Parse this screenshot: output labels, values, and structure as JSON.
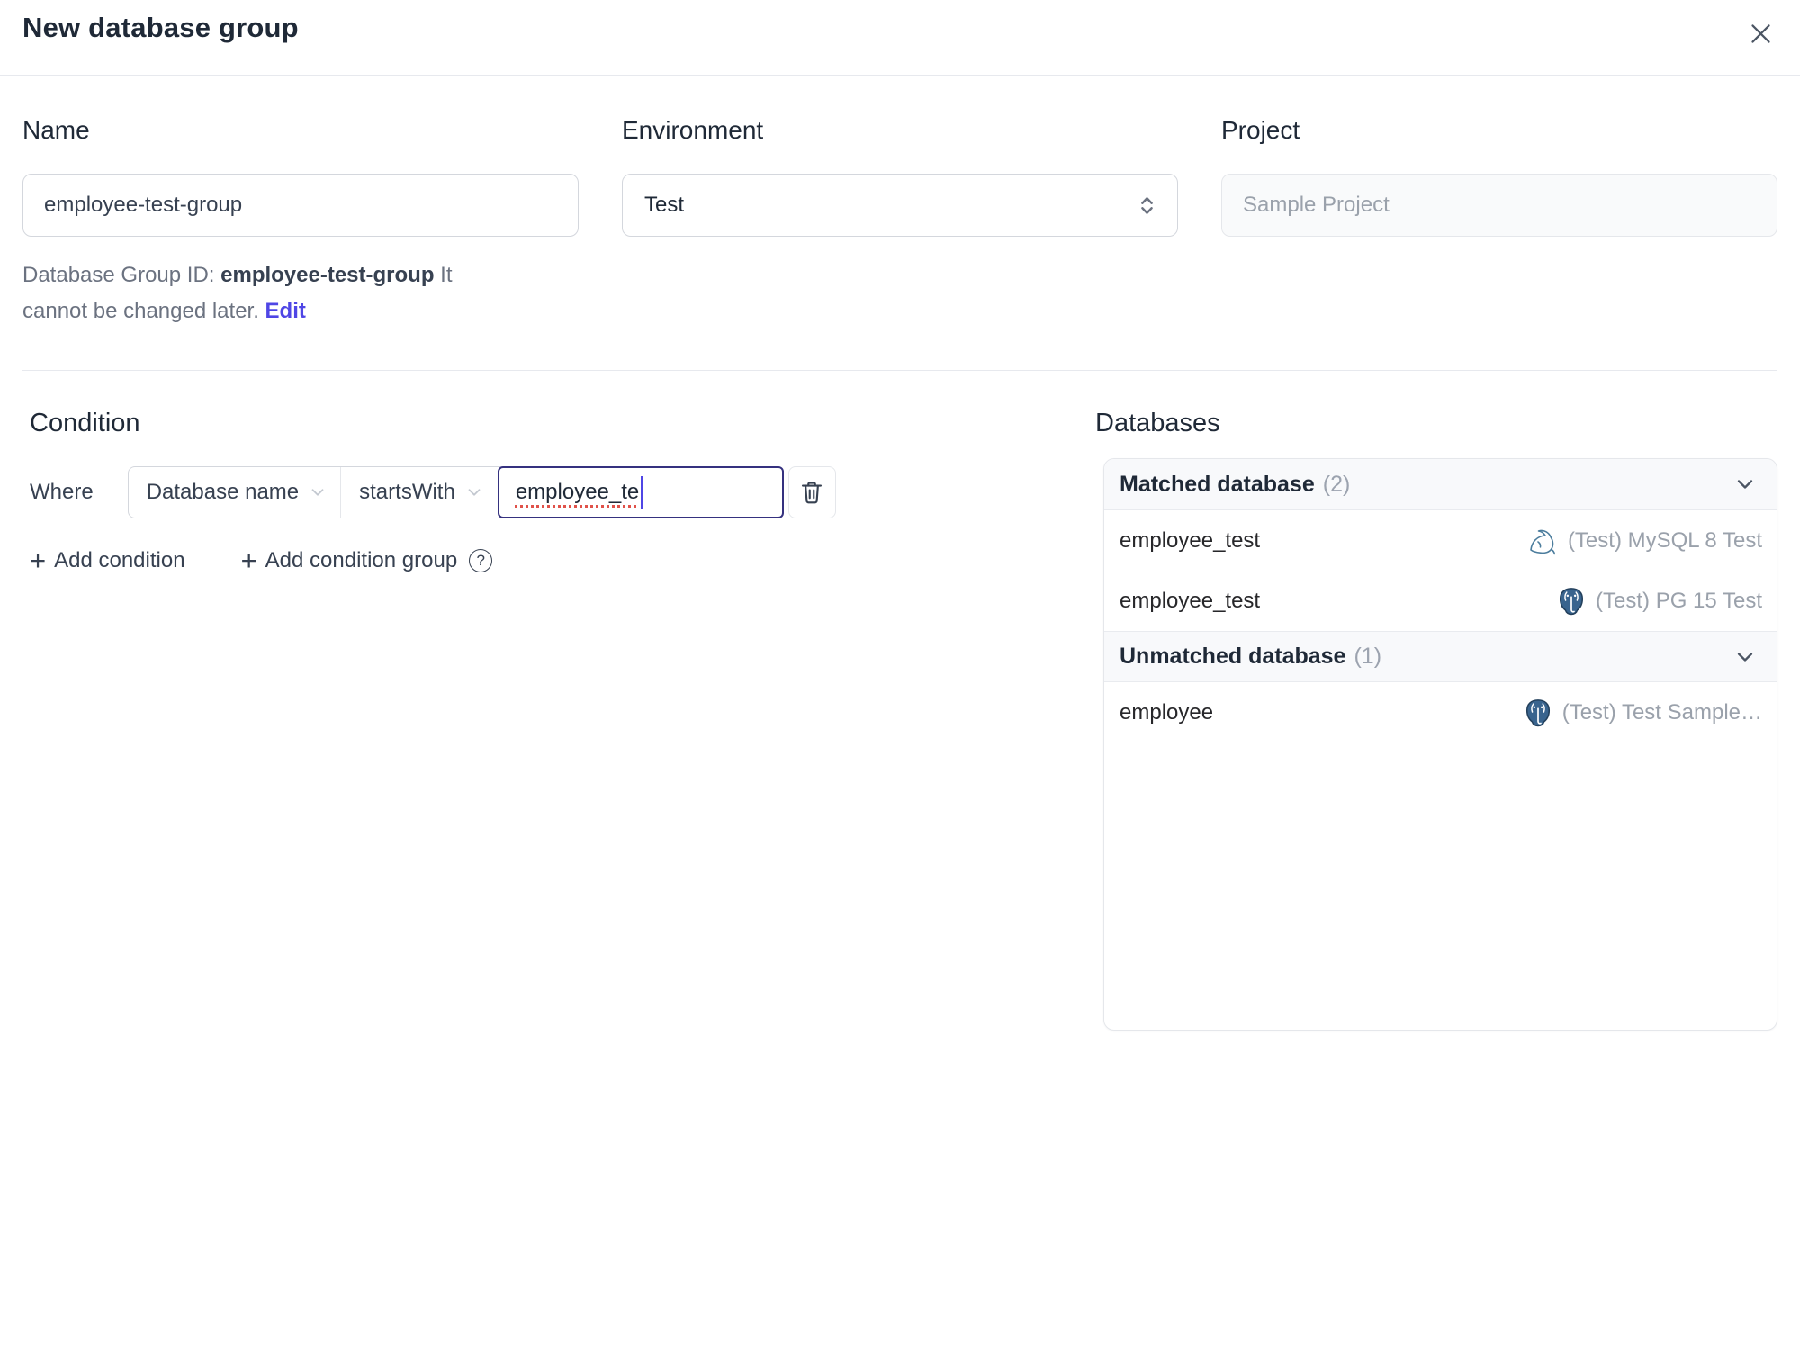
{
  "dialog": {
    "title": "New database group"
  },
  "form": {
    "name": {
      "label": "Name",
      "value": "employee-test-group"
    },
    "environment": {
      "label": "Environment",
      "value": "Test"
    },
    "project": {
      "label": "Project",
      "value": "Sample Project"
    },
    "id_hint": {
      "prefix": "Database Group ID: ",
      "id": "employee-test-group",
      "suffix": " It cannot be changed later. ",
      "edit_label": "Edit"
    }
  },
  "condition": {
    "heading": "Condition",
    "where_label": "Where",
    "field_selected": "Database name",
    "operator_selected": "startsWith",
    "value": "employee_te",
    "plus_glyph": "+",
    "add_condition_label": "Add condition",
    "add_condition_group_label": "Add condition group",
    "help_glyph": "?"
  },
  "databases": {
    "heading": "Databases",
    "groups": [
      {
        "title": "Matched database",
        "count": "(2)",
        "rows": [
          {
            "name": "employee_test",
            "instance": "(Test) MySQL 8 Test",
            "engine": "mysql"
          },
          {
            "name": "employee_test",
            "instance": "(Test) PG 15 Test",
            "engine": "postgresql"
          }
        ]
      },
      {
        "title": "Unmatched database",
        "count": "(1)",
        "rows": [
          {
            "name": "employee",
            "instance": "(Test) Test Sample…",
            "engine": "postgresql"
          }
        ]
      }
    ]
  },
  "colors": {
    "accent_indigo": "#4f46e5",
    "focus_border": "#35317f",
    "border": "#d4d7dd",
    "panel_border": "#e5e7eb",
    "muted_text": "#9ca3af",
    "gray_text": "#6b7280",
    "dark_text": "#1f2937",
    "mysql_icon": "#4c7d9d",
    "postgres_icon": "#39648e",
    "spellcheck_red": "#e0524a"
  }
}
